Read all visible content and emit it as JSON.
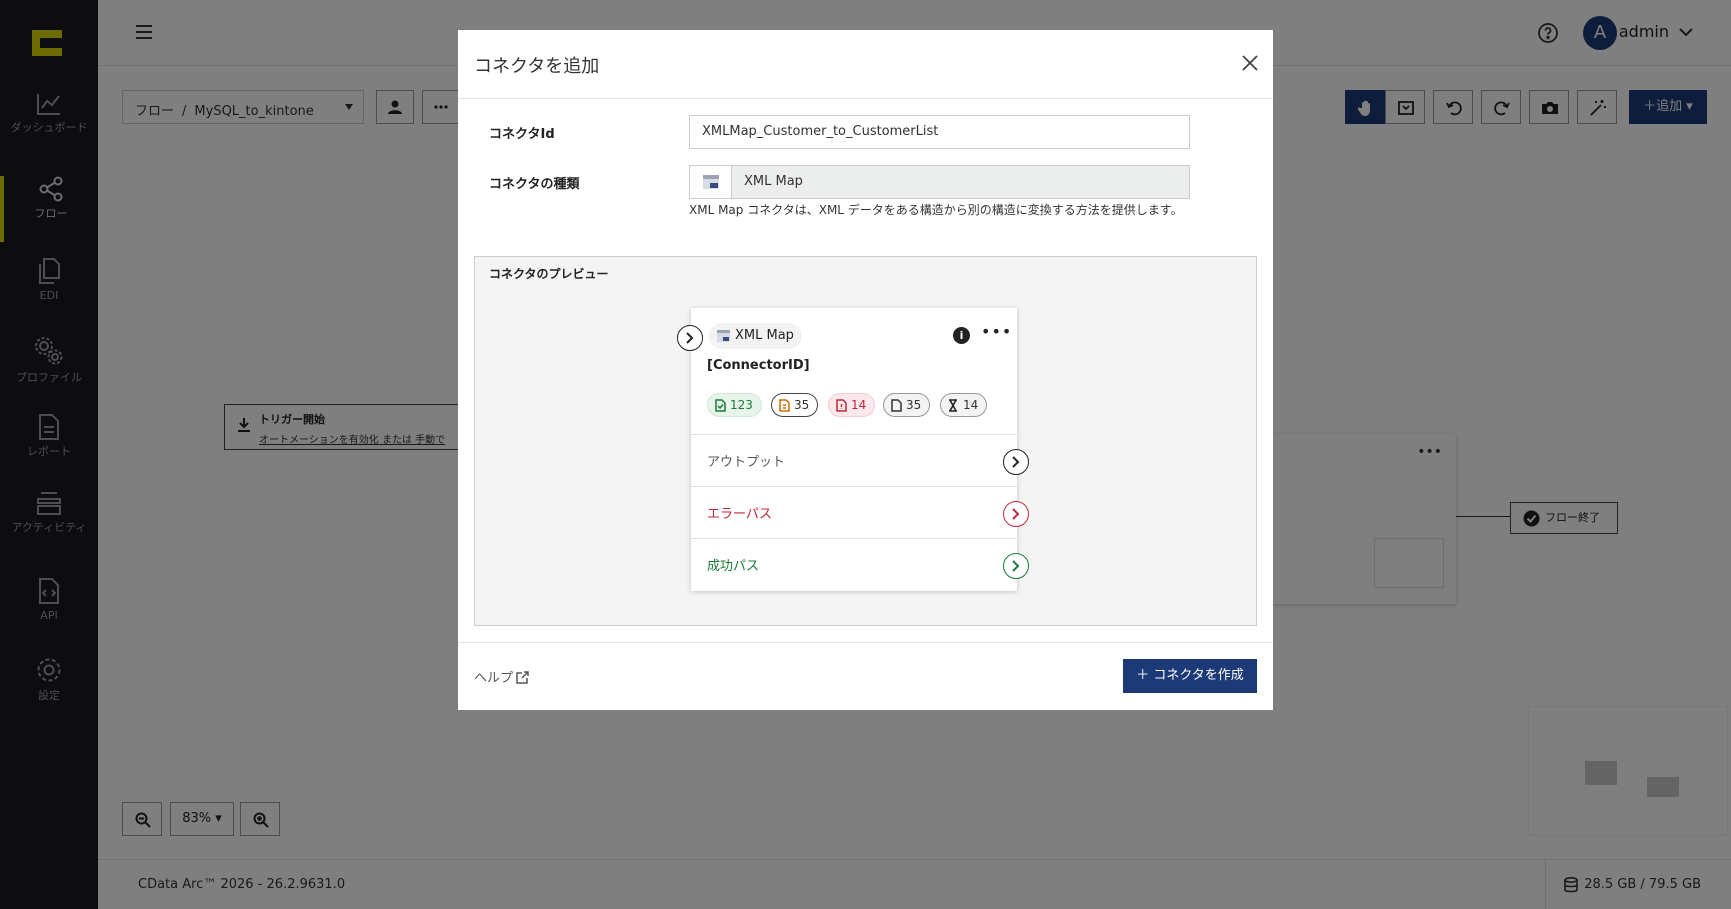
{
  "sidebar": {
    "logo": "cdata-logo",
    "items": [
      {
        "label": "ダッシュボード",
        "icon": "chart-icon"
      },
      {
        "label": "フロー",
        "icon": "share-icon"
      },
      {
        "label": "EDI",
        "icon": "documents-icon"
      },
      {
        "label": "プロファイル",
        "icon": "gears-icon"
      },
      {
        "label": "レポート",
        "icon": "report-icon"
      },
      {
        "label": "アクティビティ",
        "icon": "stack-icon"
      },
      {
        "label": "API",
        "icon": "api-icon"
      },
      {
        "label": "設定",
        "icon": "gear-icon"
      }
    ]
  },
  "topbar": {
    "avatar_initial": "A",
    "user": "admin"
  },
  "canvas": {
    "breadcrumb_root": "フロー",
    "breadcrumb_sep": "/",
    "flow_name": "MySQL_to_kintone",
    "add_label": "追加",
    "trigger_title": "トリガー開始",
    "trigger_desc": "オートメーションを有効化 または 手動で",
    "end_label": "フロー終了",
    "zoom_level": "83%"
  },
  "footer": {
    "copyright": "CData Arc™ 2026 - 26.2.9631.0",
    "storage": "28.5 GB / 79.5 GB"
  },
  "modal": {
    "title": "コネクタを追加",
    "id_label": "コネクタId",
    "id_value": "XMLMap_Customer_to_CustomerList",
    "type_label": "コネクタの種類",
    "type_value": "XML Map",
    "type_desc": "XML Map コネクタは、XML データをある構造から別の構造に変換する方法を提供します。",
    "preview_title": "コネクタのプレビュー",
    "preview": {
      "type_name": "XML Map",
      "connector_id": "[ConnectorID]",
      "badges": {
        "green": "123",
        "orange": "35",
        "red": "14",
        "gray": "35",
        "x": "14"
      },
      "output_label": "アウトプット",
      "error_label": "エラーパス",
      "success_label": "成功パス"
    },
    "help_label": "ヘルプ",
    "create_label": "コネクタを作成"
  },
  "colors": {
    "sidebar_bg": "#1a1b1f",
    "accent_yellow": "#d9d900",
    "primary_blue": "#1d3a78",
    "error_red": "#c0283a",
    "success_green": "#1b7a3a"
  }
}
